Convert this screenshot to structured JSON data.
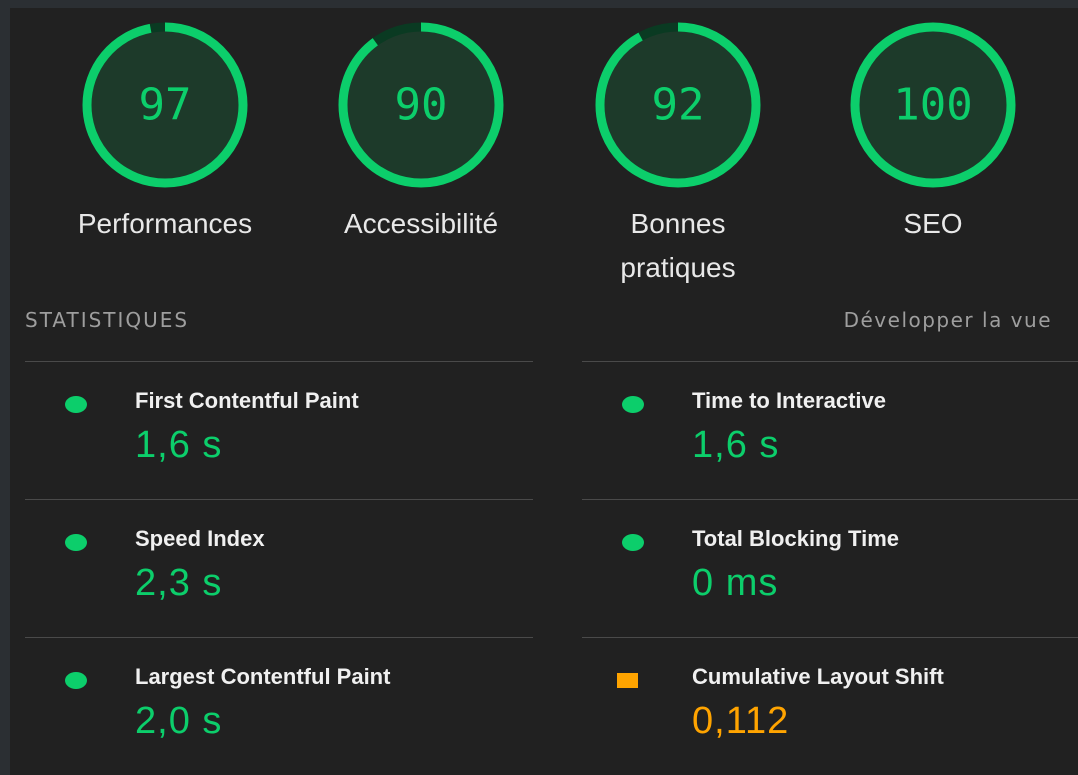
{
  "colors": {
    "pass": "#0cce6b",
    "average": "#ffa400",
    "background": "#212121"
  },
  "gauges": [
    {
      "score": "97",
      "value": 97,
      "label": "Performances",
      "status": "pass"
    },
    {
      "score": "90",
      "value": 90,
      "label": "Accessibilité",
      "status": "pass"
    },
    {
      "score": "92",
      "value": 92,
      "label": "Bonnes pratiques",
      "status": "pass"
    },
    {
      "score": "100",
      "value": 100,
      "label": "SEO",
      "status": "pass"
    }
  ],
  "stats": {
    "title": "STATISTIQUES",
    "expand_label": "Développer la vue"
  },
  "metrics": [
    {
      "title": "First Contentful Paint",
      "value": "1,6 s",
      "status": "pass",
      "marker": "circle"
    },
    {
      "title": "Time to Interactive",
      "value": "1,6 s",
      "status": "pass",
      "marker": "circle"
    },
    {
      "title": "Speed Index",
      "value": "2,3 s",
      "status": "pass",
      "marker": "circle"
    },
    {
      "title": "Total Blocking Time",
      "value": "0 ms",
      "status": "pass",
      "marker": "circle"
    },
    {
      "title": "Largest Contentful Paint",
      "value": "2,0 s",
      "status": "pass",
      "marker": "circle"
    },
    {
      "title": "Cumulative Layout Shift",
      "value": "0,112",
      "status": "average",
      "marker": "square"
    }
  ]
}
